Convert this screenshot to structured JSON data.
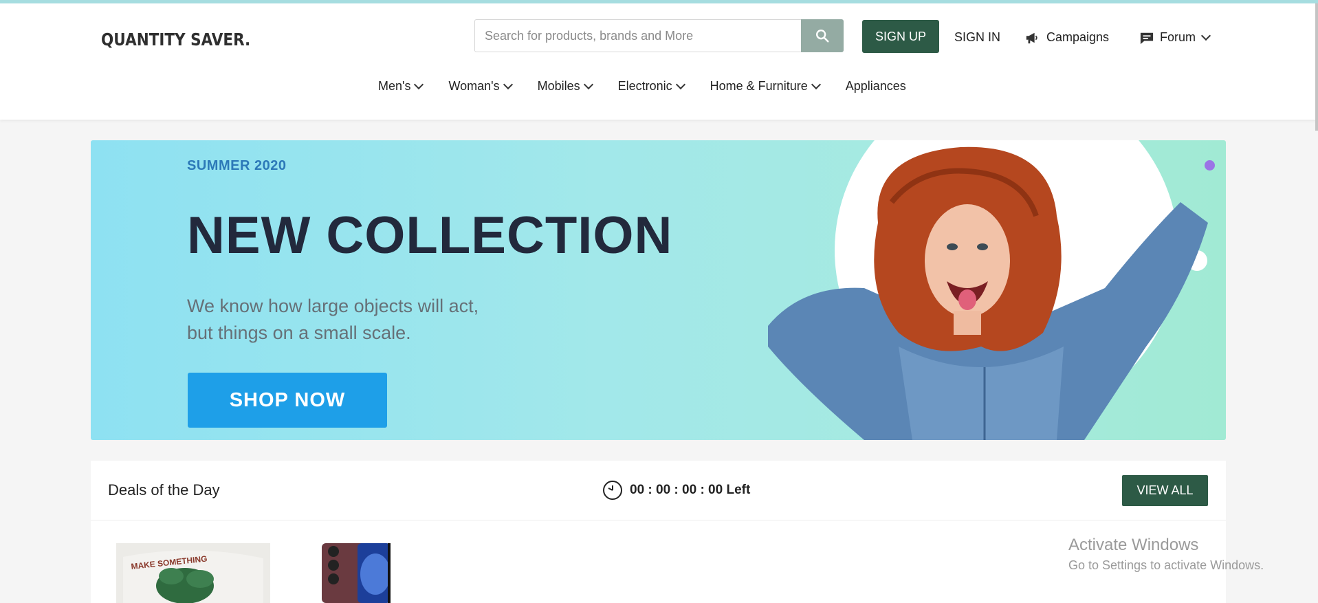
{
  "brand": {
    "logo_text": "QUANTITY SAVER."
  },
  "search": {
    "placeholder": "Search for products, brands and More"
  },
  "header": {
    "signup_label": "SIGN UP",
    "signin_label": "SIGN IN",
    "campaigns_label": "Campaigns",
    "forum_label": "Forum"
  },
  "nav": {
    "items": [
      {
        "label": "Men's",
        "dropdown": true
      },
      {
        "label": "Woman's",
        "dropdown": true
      },
      {
        "label": "Mobiles",
        "dropdown": true
      },
      {
        "label": "Electronic",
        "dropdown": true
      },
      {
        "label": "Home & Furniture",
        "dropdown": true
      },
      {
        "label": "Appliances",
        "dropdown": false
      }
    ]
  },
  "hero": {
    "tag": "SUMMER 2020",
    "title": "NEW COLLECTION",
    "subtitle_line1": "We know how large objects will act,",
    "subtitle_line2": "but things on a small scale.",
    "cta_label": "SHOP NOW"
  },
  "deals": {
    "title": "Deals of the Day",
    "timer": "00 : 00 : 00 : 00 Left",
    "view_all_label": "VIEW ALL",
    "product1_print": "MAKE SOMETHING"
  },
  "os_watermark": {
    "line1": "Activate Windows",
    "line2": "Go to Settings to activate Windows."
  },
  "colors": {
    "brand_green": "#2d5a46",
    "search_button": "#94aba3",
    "cta_blue": "#1e9fe8",
    "hero_title": "#22293c",
    "hero_tag": "#2c79b8"
  }
}
